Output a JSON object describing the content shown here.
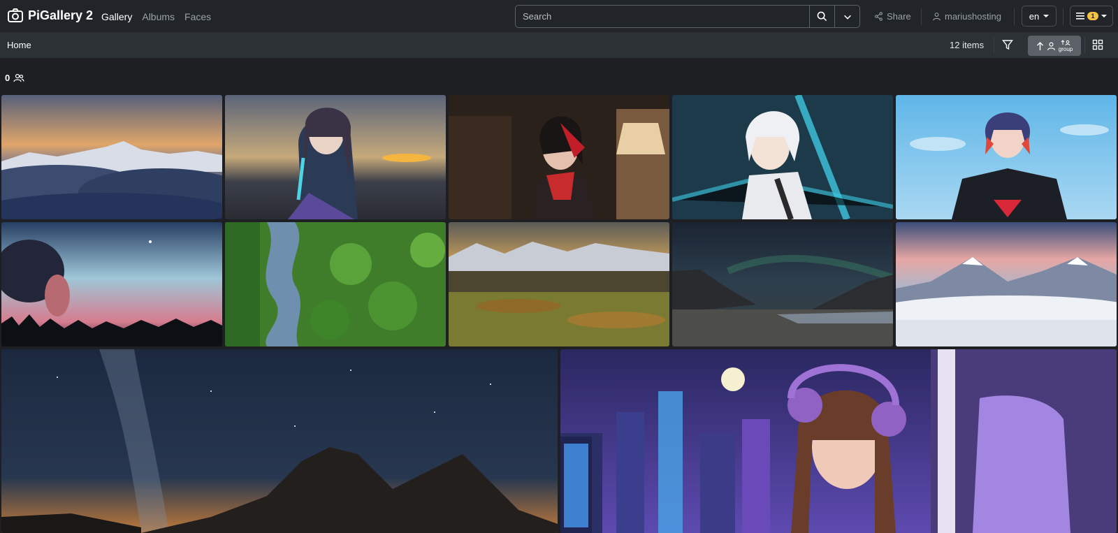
{
  "app": {
    "title": "PiGallery 2"
  },
  "nav": {
    "gallery": "Gallery",
    "albums": "Albums",
    "faces": "Faces"
  },
  "search": {
    "placeholder": "Search"
  },
  "toolbar": {
    "share": "Share",
    "user": "mariushosting",
    "lang": "en",
    "notifications": "1"
  },
  "subbar": {
    "breadcrumb": "Home",
    "item_count": "12 items",
    "sort_group": "group"
  },
  "faces": {
    "count": "0"
  },
  "photos": [
    {
      "name": "clouds-mountains"
    },
    {
      "name": "anime-girl-sunset"
    },
    {
      "name": "anime-red-scarf"
    },
    {
      "name": "anime-white-hair"
    },
    {
      "name": "supergirl-art"
    },
    {
      "name": "night-sky-trees"
    },
    {
      "name": "aerial-forest-river"
    },
    {
      "name": "mountain-valley"
    },
    {
      "name": "aurora-lake"
    },
    {
      "name": "snowy-peaks"
    },
    {
      "name": "milky-way-rocks"
    },
    {
      "name": "lofi-headphones-girl"
    }
  ]
}
